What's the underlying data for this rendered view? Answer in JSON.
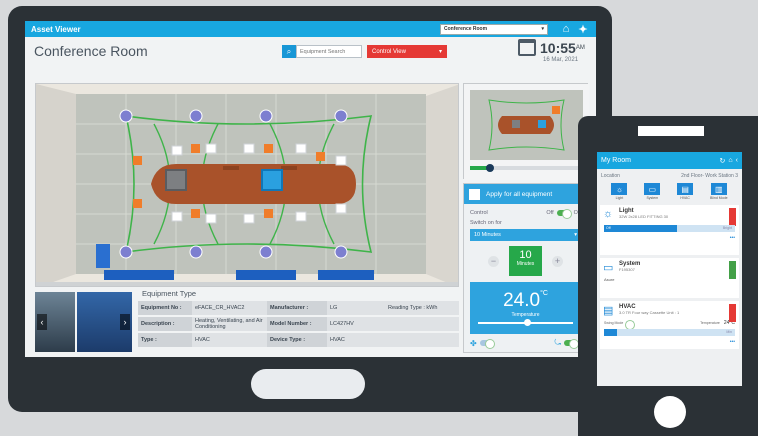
{
  "app": {
    "title": "Asset Viewer",
    "room_select": "Conference Room",
    "page_title": "Conference Room",
    "search_placeholder": "Equipment Search",
    "view_select": "Control View",
    "time": "10:55",
    "ampm": "AM",
    "date": "16 Mar, 2021"
  },
  "equipment": {
    "section_title": "Equipment Type",
    "rows": [
      {
        "k1": "Equipment No :",
        "v1": "eFACE_CR_HVAC2",
        "k2": "Manufacturer :",
        "v2": "LG",
        "k3": "Reading Type : kWh"
      },
      {
        "k1": "Description :",
        "v1": "Heating, Ventilating, and Air Conditioning",
        "k2": "Model Number :",
        "v2": "LC427HV",
        "k3": ""
      },
      {
        "k1": "Type :",
        "v1": "HVAC",
        "k2": "Device Type :",
        "v2": "HVAC",
        "k3": ""
      }
    ]
  },
  "control": {
    "apply_label": "Apply for all equipment",
    "control_label": "Control",
    "off_label": "Off",
    "on_label": "On",
    "switch_label": "Switch on for",
    "duration": "10 Minutes",
    "minutes_value": "10",
    "minutes_unit": "Minutes",
    "temperature": "24.0",
    "temperature_unit": "°C",
    "temperature_label": "Temperature"
  },
  "phone": {
    "title": "My Room",
    "location_label": "Location",
    "location_value": "2nd Floor- Work Station 3",
    "categories": [
      "Light",
      "System",
      "HVAC",
      "Blind Mode"
    ],
    "light": {
      "name": "Light",
      "desc": "32W 2x28 LED FITTING 30",
      "bar_left": "Off",
      "bar_right": "Bright"
    },
    "system": {
      "name": "System",
      "desc": "F195307",
      "extra": "Asure"
    },
    "hvac": {
      "name": "HVAC",
      "desc": "3.0 TR Four way Cassette Unit : 1",
      "swing": "Swing Mode",
      "temp_label": "Temperature",
      "temp": "24°C",
      "min": "Min"
    }
  },
  "colors": {
    "accent": "#18a7e0",
    "red": "#e53935",
    "green": "#26a84a"
  }
}
